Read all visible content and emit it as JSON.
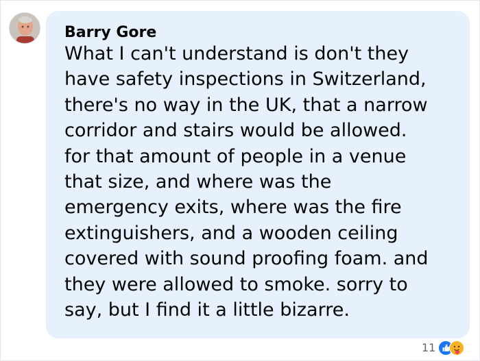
{
  "comment": {
    "author": "Barry Gore",
    "text_lines": [
      "What I can't understand is don't they",
      "have safety inspections in Switzerland,",
      "there's no way in the UK, that a narrow",
      "corridor and stairs would be allowed.",
      "for that amount of people in a venue",
      "that size, and where was the",
      "emergency exits, where was the fire",
      "extinguishers, and a wooden ceiling",
      "covered with sound proofing foam. and",
      "they were allowed to smoke. sorry to",
      "say, but I find it a little bizarre."
    ],
    "bubble_color": "#e6f1fd",
    "reactions": {
      "count": "11",
      "icons": [
        "like-icon",
        "care-icon"
      ]
    }
  }
}
